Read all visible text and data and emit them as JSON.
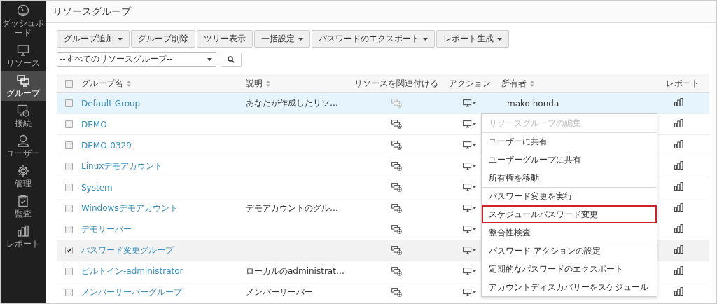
{
  "sidebar": {
    "items": [
      {
        "label": "ダッシュボード",
        "kind": "dashboard",
        "selected": false
      },
      {
        "label": "リソース",
        "kind": "monitor",
        "selected": false
      },
      {
        "label": "グループ",
        "kind": "group",
        "selected": true
      },
      {
        "label": "接続",
        "kind": "connect",
        "selected": false
      },
      {
        "label": "ユーザー",
        "kind": "user",
        "selected": false
      },
      {
        "label": "管理",
        "kind": "gear",
        "selected": false
      },
      {
        "label": "監査",
        "kind": "clipboard",
        "selected": false
      },
      {
        "label": "レポート",
        "kind": "chart",
        "selected": false
      }
    ]
  },
  "page_title": "リソースグループ",
  "toolbar": [
    {
      "label": "グループ追加",
      "dropdown": true
    },
    {
      "label": "グループ削除",
      "dropdown": false
    },
    {
      "label": "ツリー表示",
      "dropdown": false
    },
    {
      "label": "一括設定",
      "dropdown": true
    },
    {
      "label": "パスワードのエクスポート",
      "dropdown": true
    },
    {
      "label": "レポート生成",
      "dropdown": true
    }
  ],
  "filter": {
    "value": "--すべてのリソースグループ--"
  },
  "table": {
    "columns": [
      {
        "label": "グループ名",
        "sortable": true
      },
      {
        "label": "説明",
        "sortable": true
      },
      {
        "label": "リソースを関連付ける",
        "sortable": false
      },
      {
        "label": "アクション",
        "sortable": false
      },
      {
        "label": "所有者",
        "sortable": true
      },
      {
        "label": "レポート",
        "sortable": false
      }
    ],
    "header_checked": false,
    "rows": [
      {
        "name": "Default Group",
        "description": "あなたが作成したリソ…",
        "owner": "mako honda",
        "checked": false,
        "selected": true,
        "link_enabled": false
      },
      {
        "name": "DEMO",
        "checked": false,
        "selected": false,
        "link_enabled": true
      },
      {
        "name": "DEMO-0329",
        "checked": false,
        "selected": false,
        "link_enabled": true
      },
      {
        "name": "Linuxデモアカウント",
        "checked": false,
        "selected": false,
        "link_enabled": true
      },
      {
        "name": "System",
        "checked": false,
        "selected": false,
        "link_enabled": true
      },
      {
        "name": "Windowsデモアカウント",
        "description": "デモアカウントのグル…",
        "checked": false,
        "selected": false,
        "link_enabled": true
      },
      {
        "name": "デモサーバー",
        "checked": false,
        "selected": false,
        "link_enabled": true
      },
      {
        "name": "パスワード変更グループ",
        "checked": true,
        "selected": false,
        "link_enabled": true
      },
      {
        "name": "ビルトイン-administrator",
        "description": "ローカルのadministrat…",
        "checked": false,
        "selected": false,
        "link_enabled": true
      },
      {
        "name": "メンバーサーバーグループ",
        "description": "メンバーサーバー",
        "checked": false,
        "selected": false,
        "link_enabled": true
      }
    ]
  },
  "action_menu": {
    "items": [
      {
        "label": "リソースグループの編集",
        "disabled": true,
        "divider_before": false,
        "highlighted": false
      },
      {
        "label": "ユーザーに共有",
        "disabled": false,
        "divider_before": true,
        "highlighted": false
      },
      {
        "label": "ユーザーグループに共有",
        "disabled": false,
        "divider_before": false,
        "highlighted": false
      },
      {
        "label": "所有権を移動",
        "disabled": false,
        "divider_before": false,
        "highlighted": false
      },
      {
        "label": "パスワード変更を実行",
        "disabled": false,
        "divider_before": true,
        "highlighted": false
      },
      {
        "label": "スケジュールパスワード変更",
        "disabled": false,
        "divider_before": false,
        "highlighted": true
      },
      {
        "label": "整合性検査",
        "disabled": false,
        "divider_before": false,
        "highlighted": false
      },
      {
        "label": "パスワード アクションの設定",
        "disabled": false,
        "divider_before": true,
        "highlighted": false
      },
      {
        "label": "定期的なパスワードのエクスポート",
        "disabled": false,
        "divider_before": false,
        "highlighted": false
      },
      {
        "label": "アカウントディスカバリーをスケジュール",
        "disabled": false,
        "divider_before": false,
        "highlighted": false
      }
    ]
  }
}
